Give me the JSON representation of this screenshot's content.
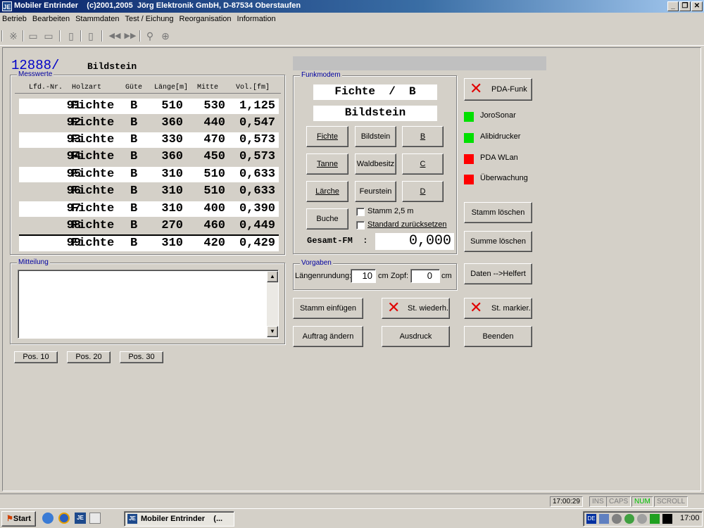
{
  "window": {
    "app_icon": "JE",
    "title": "Mobiler Entrinder    (c)2001,2005  Jörg Elektronik GmbH, D-87534 Oberstaufen",
    "min_glyph": "_",
    "max_glyph": "❐",
    "close_glyph": "✕"
  },
  "menu": [
    "Betrieb",
    "Bearbeiten",
    "Stammdaten",
    "Test / Eichung",
    "Reorganisation",
    "Information"
  ],
  "toolbar_icons": {
    "settings": "※",
    "open": "▭",
    "display": "▭",
    "page": "▯",
    "trash": "▯",
    "prev": "◀◀",
    "next": "▶▶",
    "search": "⚲",
    "zoom": "⊕"
  },
  "header": {
    "order": "12888/",
    "location": "Bildstein"
  },
  "messwerte": {
    "title": "Messwerte",
    "columns": [
      "Lfd.-Nr.",
      "Holzart",
      "Güte",
      "Länge[m]",
      "Mitte",
      "Vol.[fm]"
    ],
    "rows": [
      {
        "nr": "91",
        "holz": "Fichte",
        "guete": "B",
        "laenge": "510",
        "mitte": "530",
        "vol": "1,125"
      },
      {
        "nr": "92",
        "holz": "Fichte",
        "guete": "B",
        "laenge": "360",
        "mitte": "440",
        "vol": "0,547"
      },
      {
        "nr": "93",
        "holz": "Fichte",
        "guete": "B",
        "laenge": "330",
        "mitte": "470",
        "vol": "0,573"
      },
      {
        "nr": "94",
        "holz": "Fichte",
        "guete": "B",
        "laenge": "360",
        "mitte": "450",
        "vol": "0,573"
      },
      {
        "nr": "95",
        "holz": "Fichte",
        "guete": "B",
        "laenge": "310",
        "mitte": "510",
        "vol": "0,633"
      },
      {
        "nr": "96",
        "holz": "Fichte",
        "guete": "B",
        "laenge": "310",
        "mitte": "510",
        "vol": "0,633"
      },
      {
        "nr": "97",
        "holz": "Fichte",
        "guete": "B",
        "laenge": "310",
        "mitte": "400",
        "vol": "0,390"
      },
      {
        "nr": "98",
        "holz": "Fichte",
        "guete": "B",
        "laenge": "270",
        "mitte": "460",
        "vol": "0,449"
      },
      {
        "nr": "99",
        "holz": "Fichte",
        "guete": "B",
        "laenge": "310",
        "mitte": "420",
        "vol": "0,429"
      }
    ]
  },
  "mitteilung": {
    "title": "Mitteilung",
    "value": ""
  },
  "pos_buttons": [
    "Pos. 10",
    "Pos. 20",
    "Pos. 30"
  ],
  "funkmodem": {
    "title": "Funkmodem",
    "selection": "Fichte  /  B",
    "location": "Bildstein",
    "species": [
      "Fichte",
      "Tanne",
      "Lärche",
      "Buche"
    ],
    "owners": [
      "Bildstein",
      "Waldbesitz",
      "Feurstein"
    ],
    "grades": [
      "B",
      "C",
      "D"
    ],
    "stamm_checkbox": "Stamm 2,5 m",
    "standard_checkbox": "Standard zurücksetzen",
    "gesamt_label": "Gesamt-FM  :",
    "gesamt_value": "0,000"
  },
  "vorgaben": {
    "title": "Vorgaben",
    "laengen_label": "Längenrundung:",
    "laengen_value": "10",
    "cm1": "cm",
    "zopf_label": "Zopf:",
    "zopf_value": "0",
    "cm2": "cm"
  },
  "right_panel": {
    "pda_funk": "PDA-Funk",
    "status": [
      {
        "label": "JoroSonar",
        "color": "#00e000"
      },
      {
        "label": "Alibidrucker",
        "color": "#00e000"
      },
      {
        "label": "PDA WLan",
        "color": "#ff0000"
      },
      {
        "label": "Überwachung",
        "color": "#ff0000"
      }
    ],
    "stamm_loeschen": "Stamm löschen",
    "summe_loeschen": "Summe löschen",
    "daten_helfert": "Daten -->Helfert"
  },
  "bottom_buttons": {
    "stamm_einfuegen": "Stamm einfügen",
    "st_wiederh": "St. wiederh.",
    "st_markier": "St. markier.",
    "auftrag_aendern": "Auftrag ändern",
    "ausdruck": "Ausdruck",
    "beenden": "Beenden",
    "x_glyph": "✕"
  },
  "statusbar": {
    "time": "17:00:29",
    "ins": "INS",
    "caps": "CAPS",
    "num": "NUM",
    "scroll": "SCROLL"
  },
  "taskbar": {
    "start": "Start",
    "task": "Mobiler Entrinder    (...",
    "lang": "DE",
    "clock": "17:00"
  }
}
